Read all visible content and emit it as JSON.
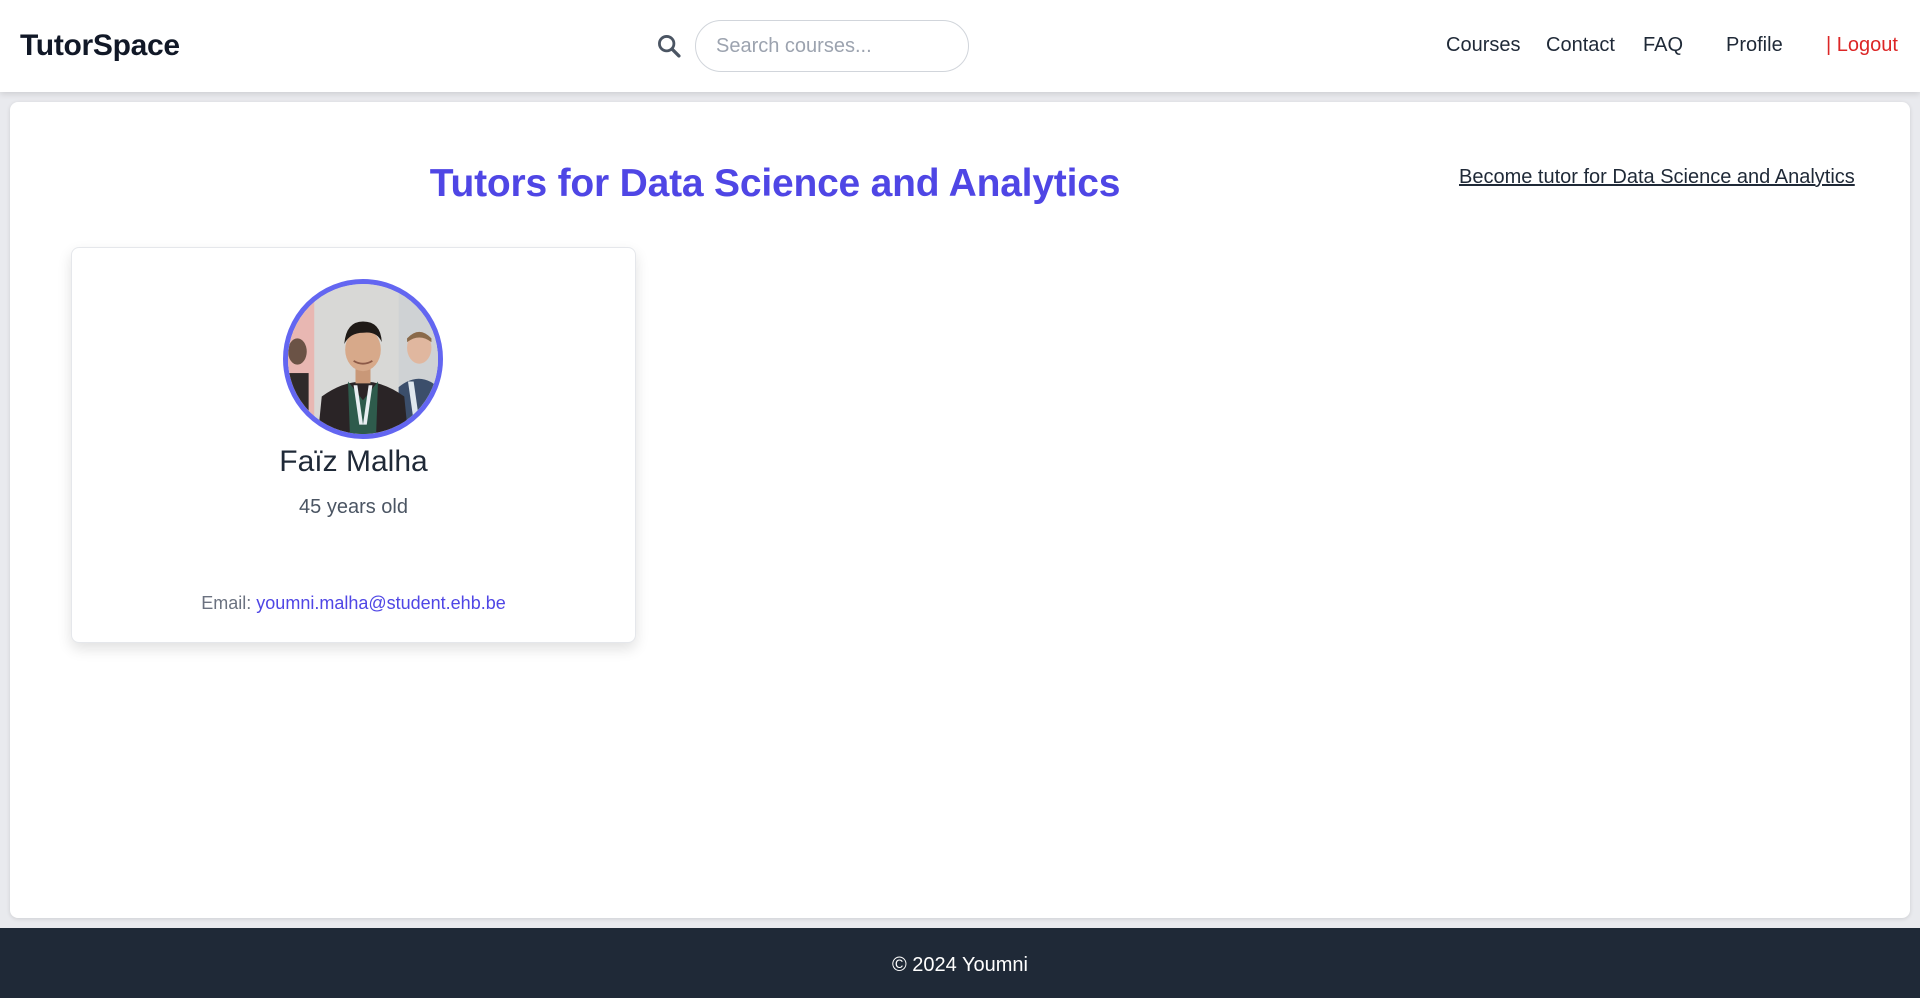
{
  "header": {
    "brand": "TutorSpace",
    "search": {
      "placeholder": "Search courses...",
      "value": "",
      "icon": "search-icon"
    },
    "nav": {
      "courses": "Courses",
      "contact": "Contact",
      "faq": "FAQ",
      "profile": "Profile",
      "logout": "| Logout"
    }
  },
  "main": {
    "title": "Tutors for Data Science and Analytics",
    "become_tutor_link": "Become tutor for Data Science and Analytics",
    "tutors": [
      {
        "name": "Faïz Malha",
        "age": "45 years old",
        "email_label": "Email:",
        "email": "youmni.malha@student.ehb.be"
      }
    ]
  },
  "footer": {
    "copyright": "© 2024 Youmni"
  },
  "colors": {
    "accent": "#4f46e5",
    "avatar_ring": "#6366f1",
    "logout": "#dc2626",
    "footer_bg": "#1f2937"
  }
}
